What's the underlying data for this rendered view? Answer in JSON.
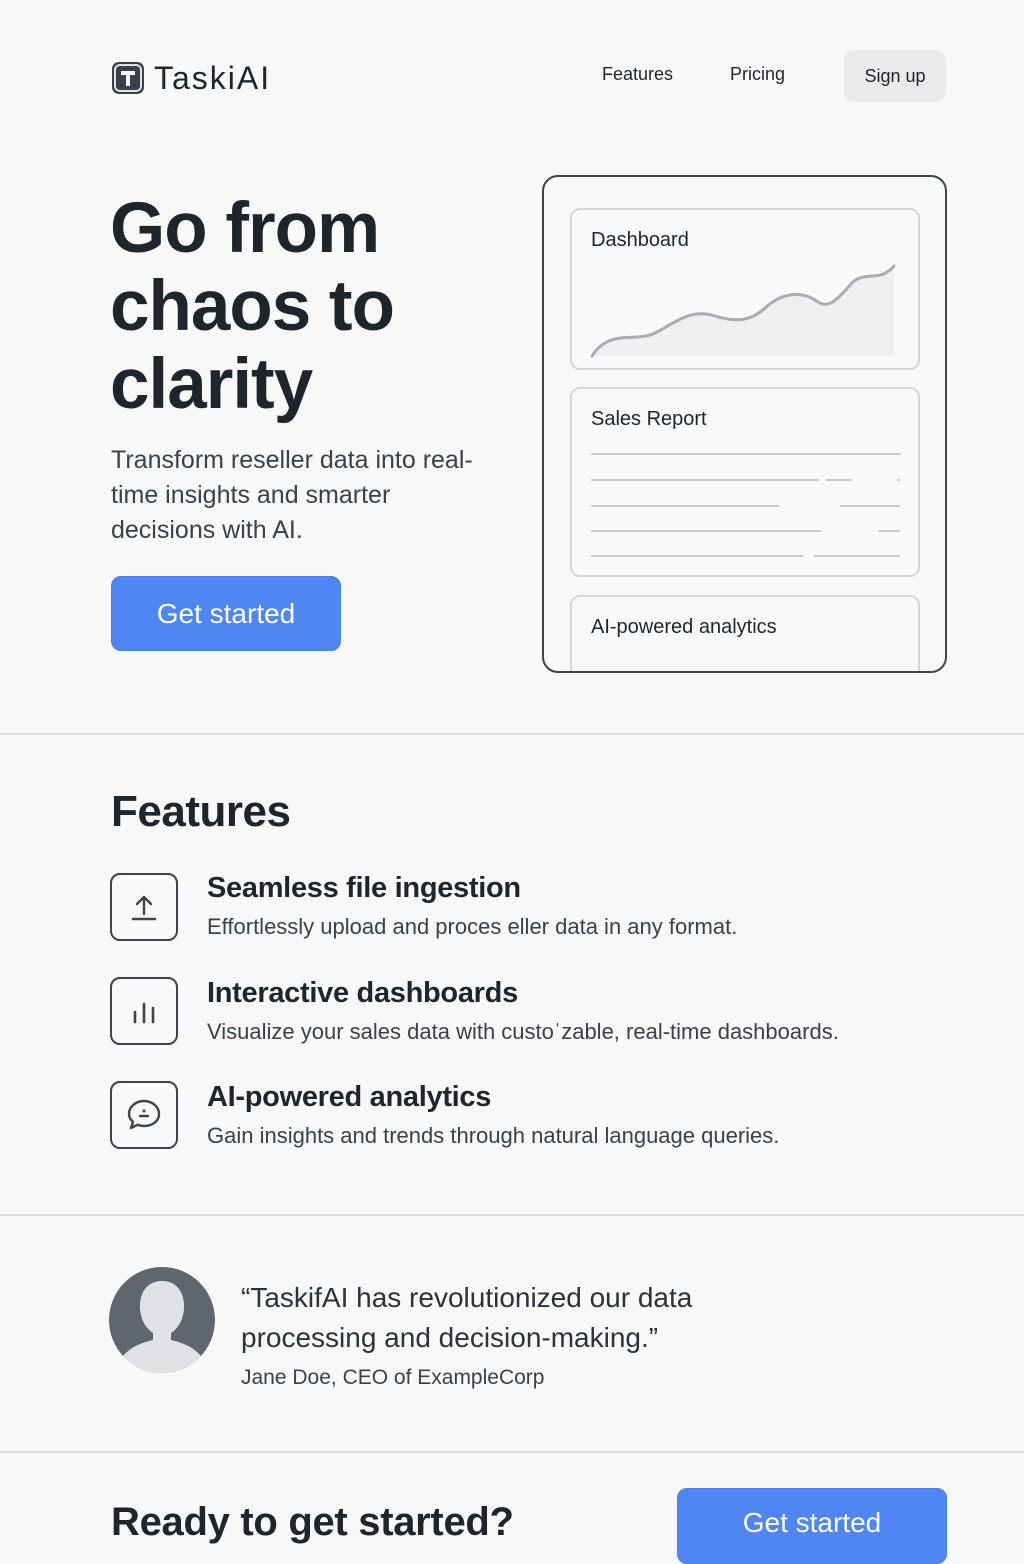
{
  "header": {
    "logo_letter": "T",
    "brand": "TaskiAI",
    "nav": {
      "features": "Features",
      "pricing": "Pricing",
      "signup": "Sign up"
    }
  },
  "hero": {
    "title": "Go from chaos to clarity",
    "subtitle": "Transform reseller data into real-time insights and smarter decisions with AI.",
    "cta": "Get started"
  },
  "mockup": {
    "dashboard_label": "Dashboard",
    "report_label": "Sales Report",
    "ai_label": "AI-powered analytics"
  },
  "features": {
    "title": "Features",
    "items": [
      {
        "icon": "upload-icon",
        "title": "Seamless file ingestion",
        "description": "Effortlessly upload and proces eller data in any format."
      },
      {
        "icon": "bar-chart-icon",
        "title": "Interactive dashboards",
        "description": "Visualize your sales data with custoˈzable, real-time dashboards."
      },
      {
        "icon": "chat-bubble-icon",
        "title": "AI-powered analytics",
        "description": "Gain insights and trends through natural language queries."
      }
    ]
  },
  "testimonial": {
    "quote": "“TaskifAI has revolutionized our data processing and decision-making.”",
    "author": "Jane Doe, CEO of ExampleCorp"
  },
  "cta": {
    "title": "Ready to get started?",
    "button": "Get started"
  },
  "colors": {
    "accent": "#4f86f3",
    "text": "#1e252d",
    "background": "#f8f8f9"
  }
}
